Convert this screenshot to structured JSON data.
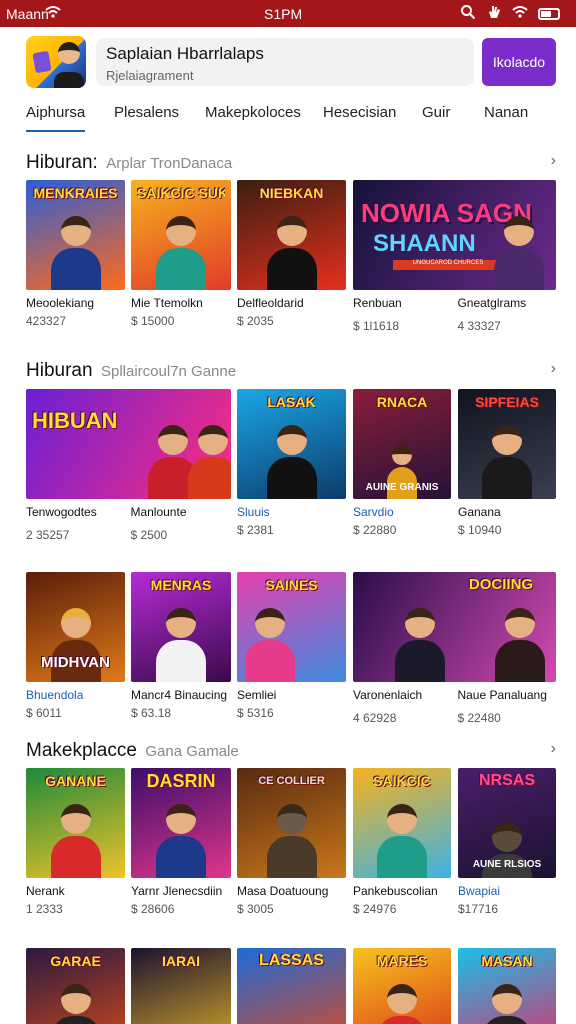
{
  "status_bar": {
    "carrier": "Maann",
    "time": "S1PM"
  },
  "header": {
    "title": "Saplaian Hbarrlalaps",
    "subtitle": "Rjelaiagrament",
    "action_label": "Ikolacdo"
  },
  "tabs": [
    {
      "label": "Aiphursa"
    },
    {
      "label": "Plesalens"
    },
    {
      "label": "Makepkoloces"
    },
    {
      "label": "Hesecisian"
    },
    {
      "label": "Guir"
    },
    {
      "label": "Nanan"
    }
  ],
  "sections": [
    {
      "title": "Hiburan:",
      "subtitle": "Arplar TronDanaca",
      "items": [
        {
          "headline": "MENKRAIES",
          "name": "Meoolekiang",
          "price": "423327",
          "colors": [
            "#2b5fd6",
            "#ff6a1a"
          ]
        },
        {
          "headline": "SAIKCIC SUKIDAC",
          "name": "Mie Ttemolkn",
          "price": "$ 15000",
          "colors": [
            "#f7b21e",
            "#e23a2a"
          ]
        },
        {
          "headline": "NIEBKAN",
          "name": "Delfleoldarid",
          "price": "$ 2035",
          "colors": [
            "#3b1e12",
            "#e6301c"
          ]
        },
        {
          "headline": "NOWIA SAGN",
          "name": "Renbuan",
          "price": "$ 1l1618",
          "colors": [
            "#16123a",
            "#6b2a8a"
          ],
          "big1": "NOWIA SAGN",
          "big2": "SHAANN",
          "strip": "UNGUCAROD CHURCES"
        },
        {
          "name": "Gneatglrams",
          "price": "4 33327"
        }
      ]
    },
    {
      "title": "Hiburan",
      "subtitle": "Spllaircoul7n Ganne",
      "items": [
        {
          "headline": "HIBUAN",
          "name": "Tenwogodtes",
          "price": "2 35257",
          "colors": [
            "#6a1fd6",
            "#ff2e7d"
          ]
        },
        {
          "name": "Manlounte",
          "price": "$ 2500"
        },
        {
          "headline": "LASAK",
          "name": "Sluuis",
          "price": "$ 2381",
          "colors": [
            "#1aa7e6",
            "#0d3a6a"
          ]
        },
        {
          "headline": "RNACA",
          "name": "Sarvdio",
          "price": "$ 22880",
          "colors": [
            "#8a1e3a",
            "#241237"
          ],
          "strip": "AUINE GRANIS"
        },
        {
          "headline": "SIPFEIAS",
          "name": "Ganana",
          "price": "$ 10940",
          "colors": [
            "#10141e",
            "#3a3f52"
          ]
        }
      ]
    },
    {
      "title": "",
      "subtitle": "",
      "items": [
        {
          "headline": "MIDHVAN",
          "name": "Bhuendola",
          "price": "$ 6011",
          "colors": [
            "#5a1e0a",
            "#e07a1a"
          ]
        },
        {
          "headline": "MENRAS",
          "name": "Mancr4 Binaucing",
          "price": "$ 63.18",
          "colors": [
            "#b42cd6",
            "#3a0a4a"
          ]
        },
        {
          "headline": "SAINES",
          "name": "Semliei",
          "price": "$ 5316",
          "colors": [
            "#e63fae",
            "#3d8ddf"
          ]
        },
        {
          "headline": "DOCIING",
          "name": "Varonenlaich",
          "price": "4 62928",
          "colors": [
            "#2a0e4a",
            "#d24ab0"
          ]
        },
        {
          "name": "Naue Panaluang",
          "price": "$ 22480"
        }
      ]
    },
    {
      "title": "Makekplacce",
      "subtitle": "Gana Gamale",
      "items": [
        {
          "headline": "GANANE",
          "name": "Nerank",
          "price": "1 2333",
          "colors": [
            "#1e8a3a",
            "#f0c22a"
          ]
        },
        {
          "headline": "DASRIN",
          "name": "Yarnr Jlenecsdiin",
          "price": "$ 28606",
          "colors": [
            "#3a0e6a",
            "#e0368a"
          ]
        },
        {
          "headline": "CE COLLIER",
          "name": "Masa Doatuoung",
          "price": "$ 3005",
          "colors": [
            "#5a2a10",
            "#c9781a"
          ]
        },
        {
          "headline": "SAIKCIC",
          "name": "Pankebuscolian",
          "price": "$ 24976",
          "colors": [
            "#f7b21e",
            "#3db2e6"
          ]
        },
        {
          "headline": "NRSAS",
          "name": "Bwapiai",
          "price": "$17716",
          "colors": [
            "#4a1e6a",
            "#1a1230"
          ],
          "strip": "AUNE RLSIOS"
        }
      ]
    },
    {
      "items": [
        {
          "headline": "GARAE",
          "colors": [
            "#2a1a40",
            "#d84a1a"
          ]
        },
        {
          "headline": "IARAI",
          "colors": [
            "#1a1230",
            "#e0b02a"
          ]
        },
        {
          "headline": "LASSAS",
          "colors": [
            "#1e6ad6",
            "#e04a1a"
          ]
        },
        {
          "headline": "MARES",
          "colors": [
            "#f7c21e",
            "#d8301a"
          ]
        },
        {
          "headline": "MASAN",
          "colors": [
            "#1ac0e6",
            "#e02a6a"
          ]
        }
      ]
    }
  ]
}
